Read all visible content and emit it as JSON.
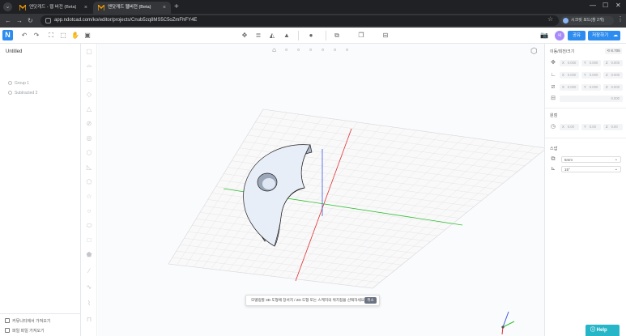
{
  "browser": {
    "tabs": [
      {
        "title": "엔닷캐드 - 웹 버전 (Beta)"
      },
      {
        "title": "엔닷캐드 웹버전 (Beta)"
      }
    ],
    "url": "app.ndotcad.com/ko/editor/projects/Cnub5zq8MS5C5oZmFhFY4E",
    "profile_label": "시크릿 모드(창 2개)"
  },
  "toolbar": {
    "avatar_initial": "씨",
    "share_label": "공유",
    "save_label": "저장하기"
  },
  "left_panel": {
    "title": "Untitled",
    "tree": [
      {
        "label": "Group 1"
      },
      {
        "label": "Subtracted 2"
      }
    ],
    "footer": [
      {
        "label": "커뮤니티에서 가져오기"
      },
      {
        "label": "파일 파일 가져오기"
      }
    ]
  },
  "right_panel": {
    "transform_title": "이동/회전/크기",
    "sync_label": "8.705",
    "position": [
      {
        "axis": "X",
        "value": "0.000"
      },
      {
        "axis": "Y",
        "value": "0.000"
      },
      {
        "axis": "Z",
        "value": "0.000"
      }
    ],
    "rotation": [
      {
        "axis": "X",
        "value": "0.000"
      },
      {
        "axis": "Y",
        "value": "0.000"
      },
      {
        "axis": "Z",
        "value": "0.000"
      }
    ],
    "scale": [
      {
        "axis": "X",
        "value": "0.000"
      },
      {
        "axis": "Y",
        "value": "0.000"
      },
      {
        "axis": "Z",
        "value": "0.000"
      }
    ],
    "extra_value": "0.000",
    "pivot_title": "원점",
    "pivot": [
      {
        "axis": "X",
        "value": "0.00"
      },
      {
        "axis": "Y",
        "value": "0.00"
      },
      {
        "axis": "Z",
        "value": "0.00"
      }
    ],
    "snap_title": "스냅",
    "snap_distance": "5mm",
    "snap_angle": "15°"
  },
  "viewport": {
    "banner_message": "모델링할 3D 도형에 장서치 / 2D 도형 또는 스케치의 위치점을 선택하세요",
    "banner_cancel": "취소"
  },
  "help_label": "Help",
  "colors": {
    "accent": "#2d8cf0",
    "help": "#27b6c8",
    "x_axis": "#e03131",
    "y_axis": "#2fbf2f",
    "z_axis": "#3b5bdb",
    "shape_fill": "#dfe7f3"
  }
}
